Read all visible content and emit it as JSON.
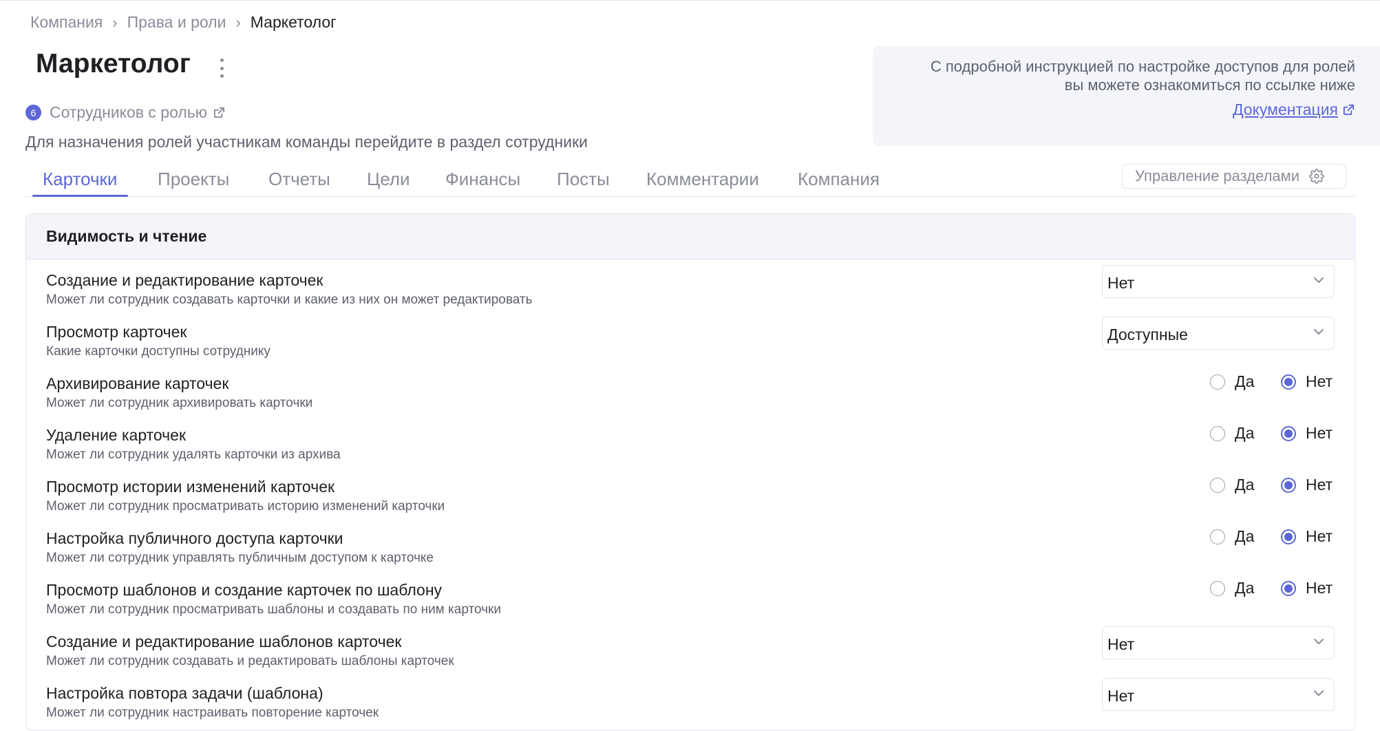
{
  "breadcrumb": {
    "items": [
      "Компания",
      "Права и роли"
    ],
    "current": "Маркетолог"
  },
  "header": {
    "title": "Маркетолог",
    "employees_count": "6",
    "employees_label": "Сотрудников с ролью",
    "hint": "Для назначения ролей участникам команды перейдите в раздел сотрудники"
  },
  "info": {
    "line1": "С подробной инструкцией по настройке доступов для ролей",
    "line2": "вы можете ознакомиться по ссылке ниже",
    "link_label": "Документация"
  },
  "tabs": [
    {
      "label": "Карточки",
      "active": true
    },
    {
      "label": "Проекты",
      "active": false
    },
    {
      "label": "Отчеты",
      "active": false
    },
    {
      "label": "Цели",
      "active": false
    },
    {
      "label": "Финансы",
      "active": false
    },
    {
      "label": "Посты",
      "active": false
    },
    {
      "label": "Комментарии",
      "active": false
    },
    {
      "label": "Компания",
      "active": false
    }
  ],
  "manage_sections_label": "Управление разделами",
  "section": {
    "title": "Видимость и чтение",
    "radio_yes": "Да",
    "radio_no": "Нет",
    "rows": [
      {
        "title": "Создание и редактирование карточек",
        "desc": "Может ли сотрудник создавать карточки и какие из них он может редактировать",
        "control": "select",
        "value": "Нет"
      },
      {
        "title": "Просмотр карточек",
        "desc": "Какие карточки доступны сотруднику",
        "control": "select",
        "value": "Доступные"
      },
      {
        "title": "Архивирование карточек",
        "desc": "Может ли сотрудник архивировать карточки",
        "control": "radio",
        "value": "Нет"
      },
      {
        "title": "Удаление карточек",
        "desc": "Может ли сотрудник удалять карточки из архива",
        "control": "radio",
        "value": "Нет"
      },
      {
        "title": "Просмотр истории изменений карточек",
        "desc": "Может ли сотрудник просматривать историю изменений карточки",
        "control": "radio",
        "value": "Нет"
      },
      {
        "title": "Настройка публичного доступа карточки",
        "desc": "Может ли сотрудник управлять публичным доступом к карточке",
        "control": "radio",
        "value": "Нет"
      },
      {
        "title": "Просмотр шаблонов и создание карточек по шаблону",
        "desc": "Может ли сотрудник просматривать шаблоны и создавать по ним карточки",
        "control": "radio",
        "value": "Нет"
      },
      {
        "title": "Создание и редактирование шаблонов карточек",
        "desc": "Может ли сотрудник создавать и редактировать шаблоны карточек",
        "control": "select",
        "value": "Нет"
      },
      {
        "title": "Настройка повтора задачи (шаблона)",
        "desc": "Может ли сотрудник настраивать повторение карточек",
        "control": "select",
        "value": "Нет"
      }
    ]
  },
  "colors": {
    "accent": "#5b67d6",
    "muted_text": "#8a8d99",
    "secondary_text": "#5d606c",
    "panel_header_bg": "#f4f5fa",
    "border": "#e3e4ea"
  }
}
